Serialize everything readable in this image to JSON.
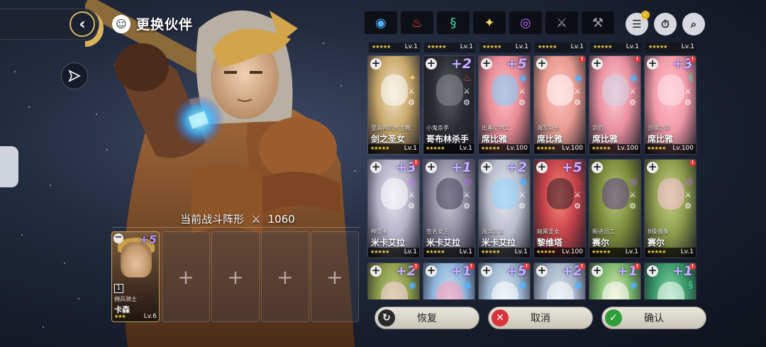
{
  "header": {
    "title": "更换伙伴",
    "back_icon": "chevron-left-icon"
  },
  "formation": {
    "title": "当前战斗阵形",
    "power": "1060",
    "slots": [
      {
        "filled": true,
        "number": "1",
        "subtitle": "佣兵骑士",
        "name": "卡森",
        "level": "Lv.6",
        "bonus": "+5",
        "stars": "★★★"
      },
      {
        "filled": false,
        "label": "+"
      },
      {
        "filled": false,
        "label": "+"
      },
      {
        "filled": false,
        "label": "+"
      },
      {
        "filled": false,
        "label": "+"
      }
    ]
  },
  "filters": [
    {
      "icon": "water-element-icon",
      "glyph": "◉",
      "color": "#4fb3ff"
    },
    {
      "icon": "fire-element-icon",
      "glyph": "♨",
      "color": "#ff4a3a"
    },
    {
      "icon": "wind-element-icon",
      "glyph": "§",
      "color": "#3fe0a0"
    },
    {
      "icon": "light-element-icon",
      "glyph": "✦",
      "color": "#f3d46a"
    },
    {
      "icon": "dark-element-icon",
      "glyph": "◎",
      "color": "#c26bff"
    },
    {
      "icon": "sword-icon",
      "glyph": "⚔",
      "color": "#9aa0a8"
    },
    {
      "icon": "hammer-icon",
      "glyph": "⚒",
      "color": "#9aa0a8"
    }
  ],
  "toprow_levels": [
    "Lv.1",
    "Lv.1",
    "Lv.1",
    "Lv.1",
    "Lv.1",
    "Lv.1"
  ],
  "row1": [
    {
      "subtitle": "至高神的大主教",
      "name": "剑之圣女",
      "level": "Lv.1",
      "bonus": "",
      "alert": false
    },
    {
      "subtitle": "小鬼杀手",
      "name": "哥布林杀手",
      "level": "Lv.1",
      "bonus": "+2",
      "alert": false
    },
    {
      "subtitle": "比基尼特工",
      "name": "席比雅",
      "level": "Lv.100",
      "bonus": "+5",
      "alert": false
    },
    {
      "subtitle": "海军队长",
      "name": "席比雅",
      "level": "Lv.100",
      "bonus": "",
      "alert": true
    },
    {
      "subtitle": "剑后",
      "name": "席比雅",
      "level": "Lv.100",
      "bonus": "",
      "alert": true
    },
    {
      "subtitle": "沙漠之花",
      "name": "席比雅",
      "level": "Lv.100",
      "bonus": "+3",
      "alert": true
    }
  ],
  "row2": [
    {
      "subtitle": "神圣者",
      "name": "米卡艾拉",
      "level": "Lv.1",
      "bonus": "+3",
      "alert": true
    },
    {
      "subtitle": "签名女王",
      "name": "米卡艾拉",
      "level": "Lv.1",
      "bonus": "+1",
      "alert": false
    },
    {
      "subtitle": "海滨正义",
      "name": "米卡艾拉",
      "level": "Lv.1",
      "bonus": "+2",
      "alert": false
    },
    {
      "subtitle": "暗黑圣女",
      "name": "黎维塔",
      "level": "Lv.100",
      "bonus": "+5",
      "alert": false
    },
    {
      "subtitle": "新进员工",
      "name": "赛尔",
      "level": "Lv.1",
      "bonus": "",
      "alert": false
    },
    {
      "subtitle": "B级偶像",
      "name": "赛尔",
      "level": "Lv.1",
      "bonus": "",
      "alert": true
    }
  ],
  "row3_bonus": [
    "+2",
    "+1",
    "+5",
    "+2",
    "+1",
    "+1"
  ],
  "buttons": {
    "restore": "恢复",
    "cancel": "取消",
    "confirm": "确认"
  }
}
